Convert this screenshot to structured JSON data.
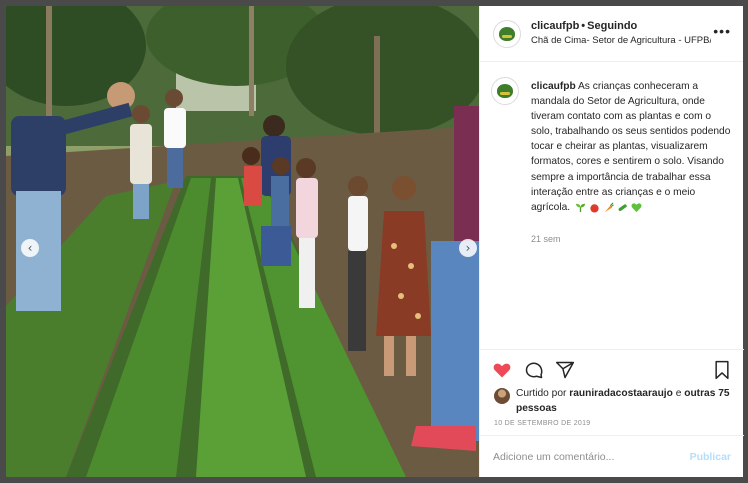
{
  "post": {
    "username": "clicaufpb",
    "follow_status": "Seguindo",
    "location": "Chã de Cima- Setor de Agricultura - UFPB/CC...",
    "more_icon": "more-dots-icon",
    "caption": "As crianças conheceram a mandala do Setor de Agricultura, onde tiveram contato com as plantas e com o solo, trabalhando os seus sentidos podendo tocar e cheirar as plantas, visualizarem formatos, cores e sentirem o solo. Visando sempre a importância de trabalhar essa interação entre as crianças e o meio agrícola.",
    "caption_emojis": [
      "seedling-emoji",
      "tomato-emoji",
      "carrot-emoji",
      "cucumber-emoji",
      "green-heart-emoji"
    ],
    "time_ago": "21 sem",
    "liked_by_prefix": "Curtido por",
    "liked_by_user": "raunirаdаcostааrаujo",
    "and_others": "e",
    "others_count": "outras 75 pessoas",
    "date": "10 DE SETEMBRO DE 2019"
  },
  "actions": {
    "like_icon": "heart-icon",
    "comment_icon": "comment-icon",
    "share_icon": "share-icon",
    "save_icon": "bookmark-icon"
  },
  "comment": {
    "placeholder": "Adicione um comentário...",
    "publish_label": "Publicar"
  },
  "carousel": {
    "prev_icon": "chevron-left-icon",
    "next_icon": "chevron-right-icon"
  },
  "colors": {
    "like_red": "#ed4956",
    "publish_disabled": "#b2dffc",
    "text_primary": "#262626",
    "text_secondary": "#8e8e8e"
  }
}
